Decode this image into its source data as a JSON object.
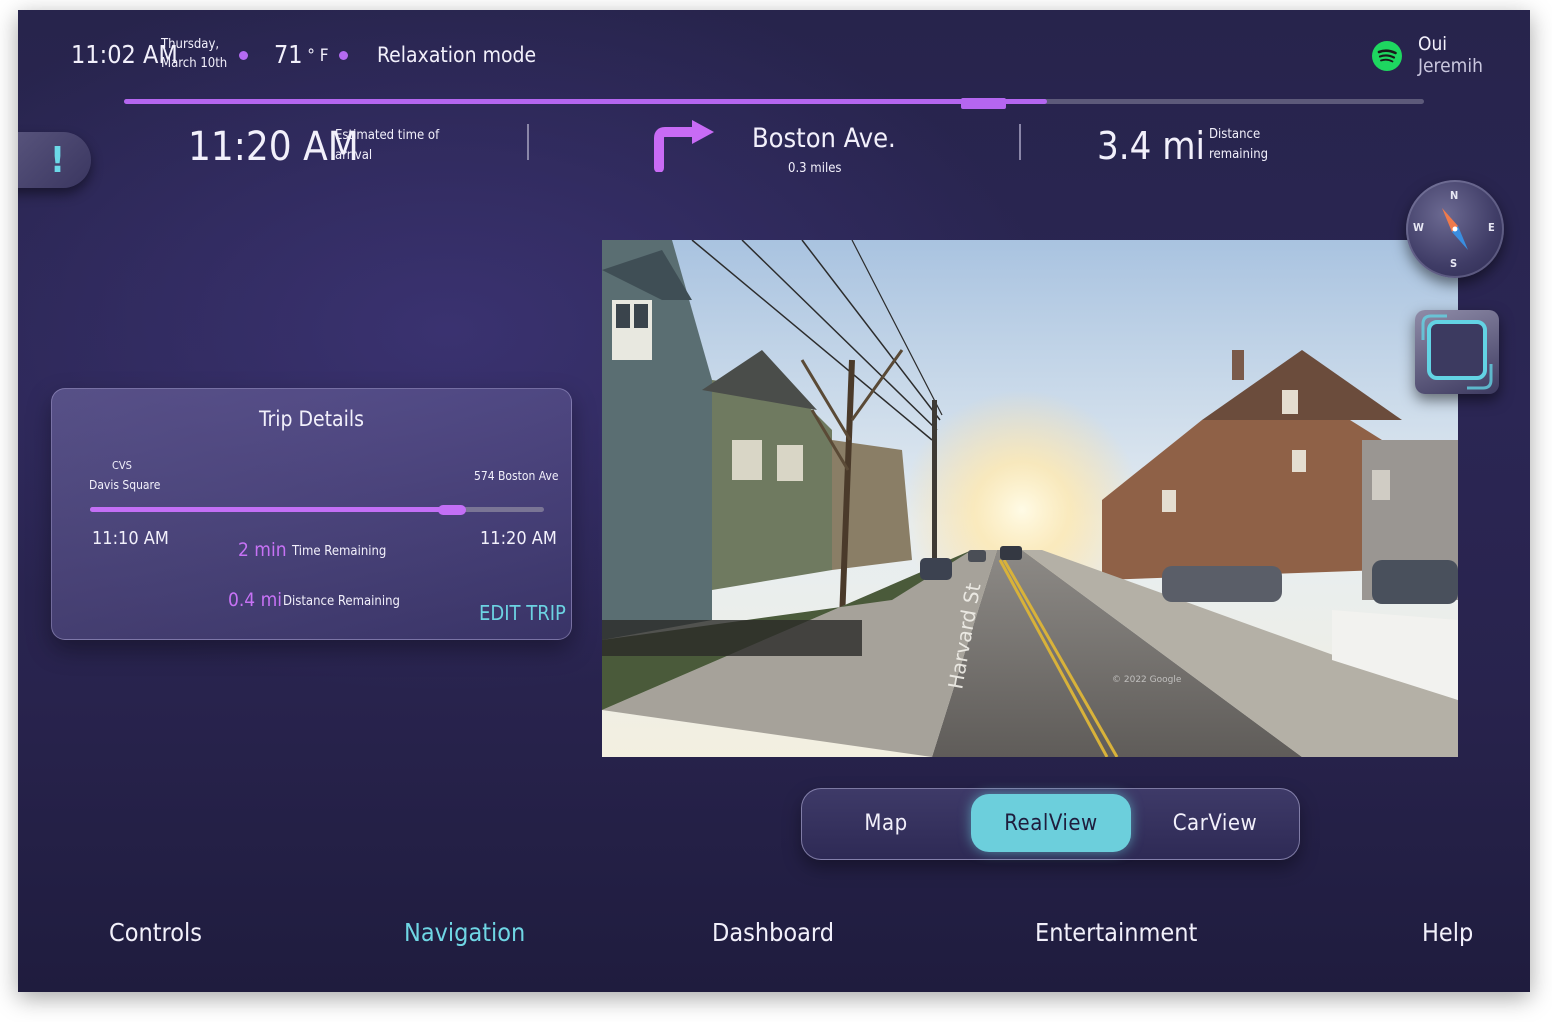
{
  "status_bar": {
    "time": "11:02 AM",
    "day": "Thursday,",
    "date": "March 10th",
    "temperature": "71",
    "temp_unit": "° F",
    "mode": "Relaxation mode",
    "music": {
      "title": "Oui",
      "artist": "Jeremih",
      "icon": "spotify-icon",
      "accent": "#1ed760"
    }
  },
  "route_progress": {
    "fraction": 0.71
  },
  "eta": {
    "time": "11:20 AM",
    "label_line1": "Estimated time of",
    "label_line2": "arrival"
  },
  "next_turn": {
    "icon": "turn-right-arrow-icon",
    "street": "Boston Ave.",
    "distance": "0.3 miles"
  },
  "distance_remaining": {
    "value": "3.4 mi",
    "label_line1": "Distance",
    "label_line2": "remaining"
  },
  "alert_button": {
    "symbol": "!"
  },
  "trip_details": {
    "title": "Trip Details",
    "origin_line1": "CVS",
    "origin_line2": "Davis Square",
    "destination": "574 Boston Ave",
    "progress_fraction": 0.8,
    "start_time": "11:10 AM",
    "end_time": "11:20 AM",
    "time_remaining_value": "2 min",
    "time_remaining_label": "Time Remaining",
    "distance_remaining_value": "0.4 mi",
    "distance_remaining_label": "Distance Remaining",
    "edit_label": "EDIT TRIP"
  },
  "street_view": {
    "street_label": "Harvard St",
    "watermark": "© 2022 Google"
  },
  "compass": {
    "n": "N",
    "e": "E",
    "s": "S",
    "w": "W"
  },
  "view_toggle": {
    "options": [
      "Map",
      "RealView",
      "CarView"
    ],
    "selected": "RealView"
  },
  "bottom_nav": {
    "items": [
      "Controls",
      "Navigation",
      "Dashboard",
      "Entertainment",
      "Help"
    ],
    "active": "Navigation"
  },
  "colors": {
    "accent_purple": "#b466f0",
    "accent_cyan": "#6ccfdc",
    "background": "#29254f"
  }
}
